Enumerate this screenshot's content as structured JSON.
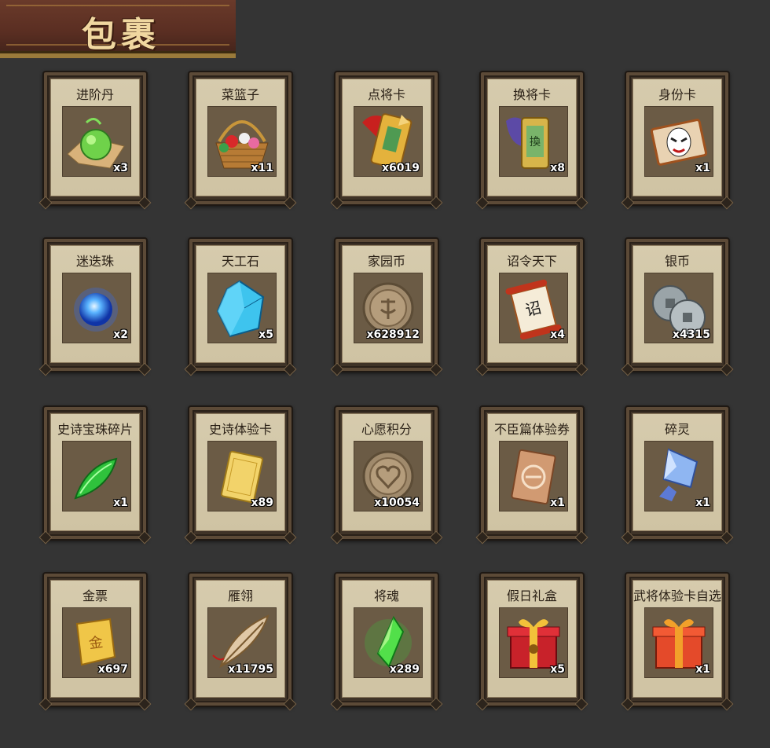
{
  "header": {
    "title": "包裹"
  },
  "items": [
    {
      "name": "进阶丹",
      "qty": "x3",
      "icon": "green-pill-icon"
    },
    {
      "name": "菜篮子",
      "qty": "x11",
      "icon": "flower-basket-icon"
    },
    {
      "name": "点将卡",
      "qty": "x6019",
      "icon": "general-card-gold-icon"
    },
    {
      "name": "换将卡",
      "qty": "x8",
      "icon": "swap-card-green-icon"
    },
    {
      "name": "身份卡",
      "qty": "x1",
      "icon": "opera-mask-card-icon"
    },
    {
      "name": "迷迭珠",
      "qty": "x2",
      "icon": "blue-orb-icon"
    },
    {
      "name": "天工石",
      "qty": "x5",
      "icon": "blue-crystal-icon"
    },
    {
      "name": "家园币",
      "qty": "x628912",
      "icon": "home-coin-icon"
    },
    {
      "name": "诏令天下",
      "qty": "x4",
      "icon": "edict-scroll-icon"
    },
    {
      "name": "银币",
      "qty": "x4315",
      "icon": "silver-coins-icon"
    },
    {
      "name": "史诗宝珠碎片",
      "qty": "x1",
      "icon": "green-shard-icon"
    },
    {
      "name": "史诗体验卡",
      "qty": "x89",
      "icon": "gold-card-icon"
    },
    {
      "name": "心愿积分",
      "qty": "x10054",
      "icon": "heart-coin-icon"
    },
    {
      "name": "不臣篇体验券",
      "qty": "x1",
      "icon": "copper-ticket-icon"
    },
    {
      "name": "碎灵",
      "qty": "x1",
      "icon": "spirit-crystal-icon"
    },
    {
      "name": "金票",
      "qty": "x697",
      "icon": "gold-scroll-icon"
    },
    {
      "name": "雁翎",
      "qty": "x11795",
      "icon": "feather-icon"
    },
    {
      "name": "将魂",
      "qty": "x289",
      "icon": "green-soul-crystal-icon"
    },
    {
      "name": "假日礼盒",
      "qty": "x5",
      "icon": "holiday-gift-box-icon"
    },
    {
      "name": "武将体验卡自选",
      "qty": "x1",
      "icon": "red-gift-box-icon"
    }
  ]
}
